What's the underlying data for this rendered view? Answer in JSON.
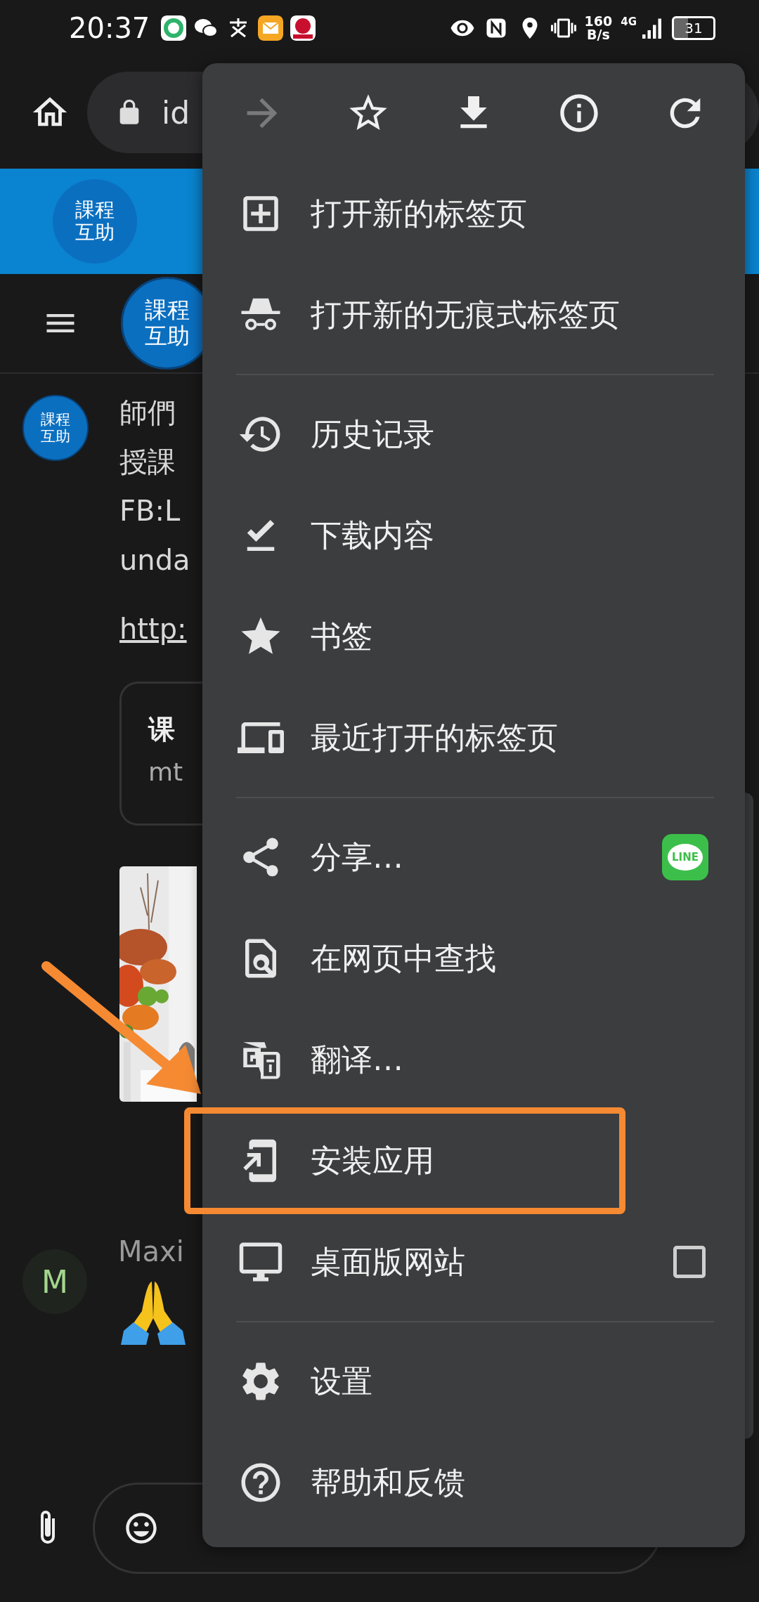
{
  "status_bar": {
    "time": "20:37",
    "net_speed": "160",
    "net_unit": "B/s",
    "network": "4G",
    "battery": "31"
  },
  "browser": {
    "url": "id"
  },
  "page": {
    "banner_logo": [
      "課程",
      "互助"
    ],
    "header_logo": [
      "課程",
      "互助"
    ],
    "message": {
      "avatar_logo": [
        "課程",
        "互助"
      ],
      "lines": [
        "師們",
        "授課",
        "FB:L",
        "unda"
      ],
      "link": "http:",
      "card_title": "课",
      "card_subtitle": "mt",
      "photo": {
        "kind": "picture"
      }
    },
    "reply": {
      "avatar": "M",
      "name": "Maxi"
    }
  },
  "menu": {
    "toolbar": [
      {
        "disabled": true
      },
      {
        "disabled": false
      },
      {
        "disabled": false
      },
      {
        "disabled": false
      },
      {
        "disabled": false
      }
    ],
    "sections": [
      [
        {
          "label": "打开新的标签页",
          "kind": "plain",
          "highlighted": false
        },
        {
          "label": "打开新的无痕式标签页",
          "kind": "plain",
          "highlighted": false
        }
      ],
      [
        {
          "label": "历史记录",
          "kind": "plain",
          "highlighted": false
        },
        {
          "label": "下载内容",
          "kind": "plain",
          "highlighted": false
        },
        {
          "label": "书签",
          "kind": "plain",
          "highlighted": false
        },
        {
          "label": "最近打开的标签页",
          "kind": "plain",
          "highlighted": false
        }
      ],
      [
        {
          "label": "分享…",
          "kind": "badge",
          "badge": "LINE",
          "highlighted": false
        },
        {
          "label": "在网页中查找",
          "kind": "plain",
          "highlighted": false
        },
        {
          "label": "翻译…",
          "kind": "plain",
          "highlighted": false
        },
        {
          "label": "安装应用",
          "kind": "plain",
          "highlighted": true
        },
        {
          "label": "桌面版网站",
          "kind": "checkbox",
          "checked": false,
          "highlighted": false
        }
      ],
      [
        {
          "label": "设置",
          "kind": "plain",
          "highlighted": false
        },
        {
          "label": "帮助和反馈",
          "kind": "plain",
          "highlighted": false
        }
      ]
    ]
  }
}
